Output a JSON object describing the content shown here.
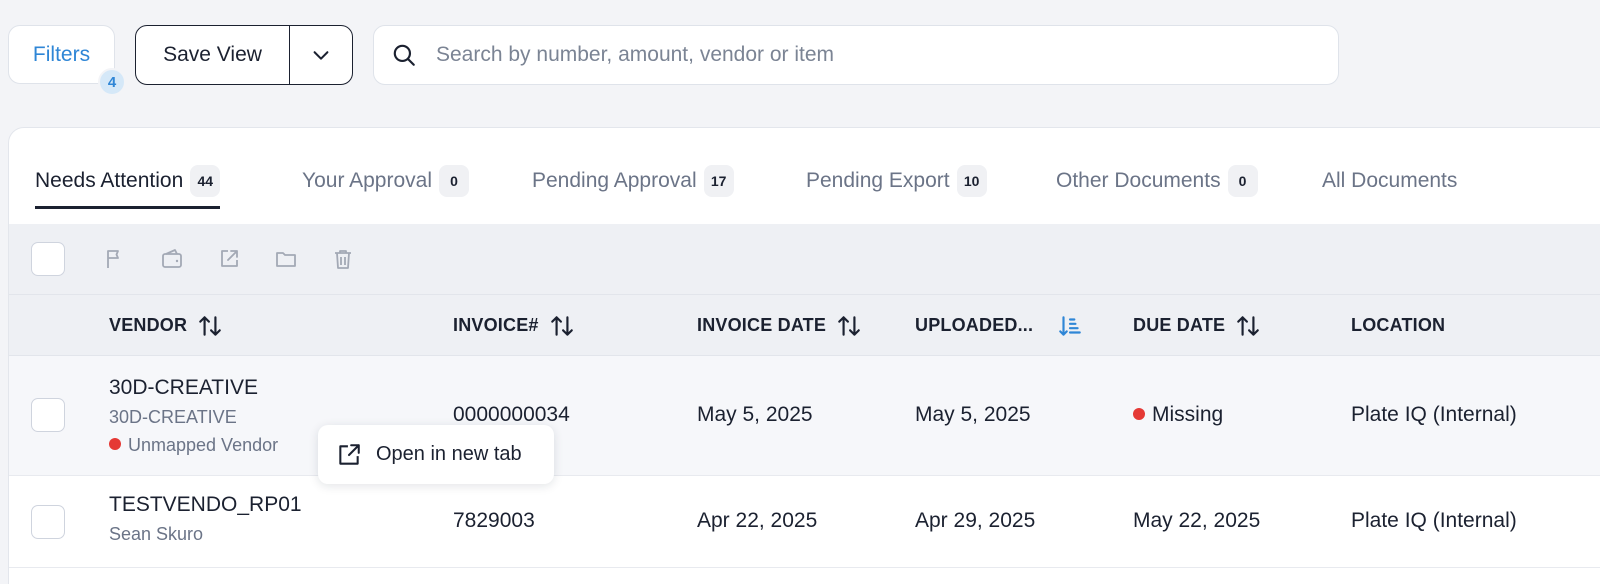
{
  "topbar": {
    "filters_label": "Filters",
    "filters_count": "4",
    "save_view_label": "Save View",
    "search_placeholder": "Search by number, amount, vendor or item"
  },
  "tabs": [
    {
      "label": "Needs Attention",
      "count": "44",
      "active": true
    },
    {
      "label": "Your Approval",
      "count": "0"
    },
    {
      "label": "Pending Approval",
      "count": "17"
    },
    {
      "label": "Pending Export",
      "count": "10"
    },
    {
      "label": "Other Documents",
      "count": "0"
    },
    {
      "label": "All Documents"
    }
  ],
  "toolbar_icons": [
    "flag-icon",
    "wallet-icon",
    "export-icon",
    "folder-icon",
    "trash-icon"
  ],
  "columns": [
    "VENDOR",
    "INVOICE#",
    "INVOICE DATE",
    "UPLOADED...",
    "DUE DATE",
    "LOCATION"
  ],
  "rows": [
    {
      "vendor": "30D-CREATIVE",
      "vendor_sub": "30D-CREATIVE",
      "vendor_status": "Unmapped Vendor",
      "invoice": "0000000034",
      "invoice_date": "May 5, 2025",
      "uploaded": "May 5, 2025",
      "due_date": "Missing",
      "location": "Plate IQ (Internal)"
    },
    {
      "vendor": "TESTVENDO_RP01",
      "vendor_sub": "Sean Skuro",
      "invoice": "7829003",
      "invoice_date": "Apr 22, 2025",
      "uploaded": "Apr 29, 2025",
      "due_date": "May 22, 2025",
      "location": "Plate IQ (Internal)"
    }
  ],
  "popup": {
    "label": "Open in new tab"
  },
  "colors": {
    "accent": "#2f86d6",
    "alert": "#e53935",
    "text": "#1b2130",
    "muted": "#6b7487"
  }
}
